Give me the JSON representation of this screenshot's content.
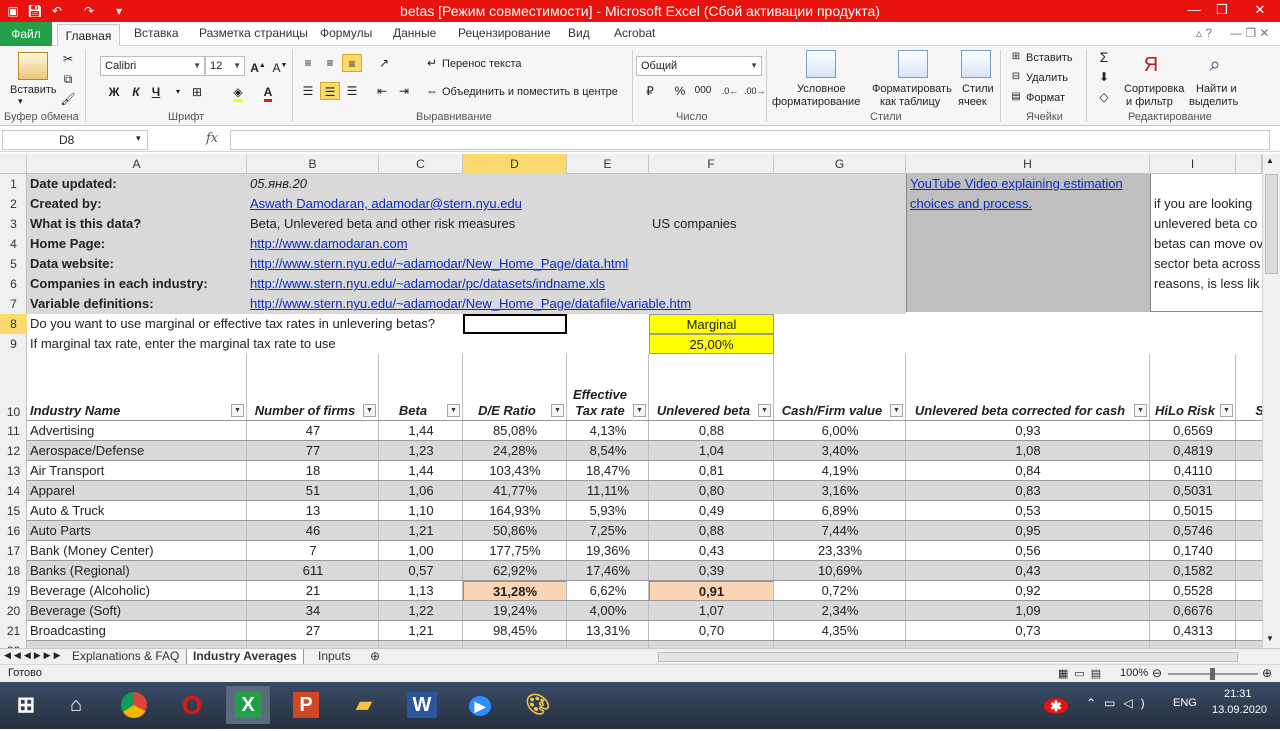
{
  "window": {
    "title": "betas  [Режим совместимости] - Microsoft Excel (Сбой активации продукта)"
  },
  "ribbon_tabs": [
    "Файл",
    "Главная",
    "Вставка",
    "Разметка страницы",
    "Формулы",
    "Данные",
    "Рецензирование",
    "Вид",
    "Acrobat"
  ],
  "ribbon": {
    "paste": "Вставить",
    "clipboard_group": "Буфер обмена",
    "font_name": "Calibri",
    "font_size": "12",
    "font_group": "Шрифт",
    "wrap_text": "Перенос текста",
    "merge_center": "Объединить и поместить в центре",
    "alignment_group": "Выравнивание",
    "number_format": "Общий",
    "number_group": "Число",
    "cond_format_1": "Условное",
    "cond_format_2": "форматирование",
    "format_table_1": "Форматировать",
    "format_table_2": "как таблицу",
    "cell_styles_1": "Стили",
    "cell_styles_2": "ячеек",
    "styles_group": "Стили",
    "insert": "Вставить",
    "delete": "Удалить",
    "format": "Формат",
    "cells_group": "Ячейки",
    "sort_1": "Сортировка",
    "sort_2": "и фильтр",
    "find_1": "Найти и",
    "find_2": "выделить",
    "editing_group": "Редактирование",
    "bold": "Ж",
    "italic": "К",
    "underline": "Ч",
    "percent": "%",
    "thousands": "000"
  },
  "formula_bar": {
    "name_box": "D8",
    "fx": "fx",
    "formula": ""
  },
  "columns": [
    "A",
    "B",
    "C",
    "D",
    "E",
    "F",
    "G",
    "H",
    "I"
  ],
  "rows": [
    "1",
    "2",
    "3",
    "4",
    "5",
    "6",
    "7",
    "8",
    "9",
    "10",
    "11",
    "12",
    "13",
    "14",
    "15",
    "16",
    "17",
    "18",
    "19",
    "20",
    "21",
    "22"
  ],
  "info": {
    "date_label": "Date updated:",
    "date_value": "05.янв.20",
    "created_label": "Created by:",
    "created_value": "Aswath Damodaran, adamodar@stern.nyu.edu",
    "what_label": "What is this data?",
    "what_value": "Beta, Unlevered beta and other risk measures",
    "what_region": "US companies",
    "home_label": "Home Page:",
    "home_value": "http://www.damodaran.com",
    "dataweb_label": "Data website:",
    "dataweb_value": "http://www.stern.nyu.edu/~adamodar/New_Home_Page/data.html",
    "companies_label": "Companies in each industry:",
    "companies_value": "http://www.stern.nyu.edu/~adamodar/pc/datasets/indname.xls",
    "vardef_label": "Variable definitions:",
    "vardef_value": "http://www.stern.nyu.edu/~adamodar/New_Home_Page/datafile/variable.htm",
    "video_link_1": "YouTube Video explaining estimation",
    "video_link_2": "choices and process.",
    "note_lines": [
      "if you are looking",
      "unlevered beta co",
      "betas can move ov",
      "sector beta across",
      "reasons, is less lik"
    ],
    "tax_question": "Do you want to use marginal or effective tax rates in unlevering betas?",
    "tax_choice": "Marginal",
    "marginal_question": "If marginal tax rate, enter the marginal tax rate to use",
    "marginal_value": "25,00%"
  },
  "table": {
    "headers": [
      "Industry  Name",
      "Number of firms",
      "Beta",
      "D/E Ratio",
      "Effective Tax rate",
      "Unlevered beta",
      "Cash/Firm value",
      "Unlevered beta corrected for cash",
      "HiLo Risk",
      "Sta"
    ],
    "rows": [
      {
        "name": "Advertising",
        "firms": "47",
        "beta": "1,44",
        "de": "85,08%",
        "tax": "4,13%",
        "ubeta": "0,88",
        "cash": "6,00%",
        "ubeta_cash": "0,93",
        "hilo": "0,6569"
      },
      {
        "name": "Aerospace/Defense",
        "firms": "77",
        "beta": "1,23",
        "de": "24,28%",
        "tax": "8,54%",
        "ubeta": "1,04",
        "cash": "3,40%",
        "ubeta_cash": "1,08",
        "hilo": "0,4819"
      },
      {
        "name": "Air Transport",
        "firms": "18",
        "beta": "1,44",
        "de": "103,43%",
        "tax": "18,47%",
        "ubeta": "0,81",
        "cash": "4,19%",
        "ubeta_cash": "0,84",
        "hilo": "0,4110"
      },
      {
        "name": "Apparel",
        "firms": "51",
        "beta": "1,06",
        "de": "41,77%",
        "tax": "11,11%",
        "ubeta": "0,80",
        "cash": "3,16%",
        "ubeta_cash": "0,83",
        "hilo": "0,5031"
      },
      {
        "name": "Auto & Truck",
        "firms": "13",
        "beta": "1,10",
        "de": "164,93%",
        "tax": "5,93%",
        "ubeta": "0,49",
        "cash": "6,89%",
        "ubeta_cash": "0,53",
        "hilo": "0,5015"
      },
      {
        "name": "Auto Parts",
        "firms": "46",
        "beta": "1,21",
        "de": "50,86%",
        "tax": "7,25%",
        "ubeta": "0,88",
        "cash": "7,44%",
        "ubeta_cash": "0,95",
        "hilo": "0,5746"
      },
      {
        "name": "Bank (Money Center)",
        "firms": "7",
        "beta": "1,00",
        "de": "177,75%",
        "tax": "19,36%",
        "ubeta": "0,43",
        "cash": "23,33%",
        "ubeta_cash": "0,56",
        "hilo": "0,1740"
      },
      {
        "name": "Banks (Regional)",
        "firms": "611",
        "beta": "0,57",
        "de": "62,92%",
        "tax": "17,46%",
        "ubeta": "0,39",
        "cash": "10,69%",
        "ubeta_cash": "0,43",
        "hilo": "0,1582"
      },
      {
        "name": "Beverage (Alcoholic)",
        "firms": "21",
        "beta": "1,13",
        "de": "31,28%",
        "tax": "6,62%",
        "ubeta": "0,91",
        "cash": "0,72%",
        "ubeta_cash": "0,92",
        "hilo": "0,5528"
      },
      {
        "name": "Beverage (Soft)",
        "firms": "34",
        "beta": "1,22",
        "de": "19,24%",
        "tax": "4,00%",
        "ubeta": "1,07",
        "cash": "2,34%",
        "ubeta_cash": "1,09",
        "hilo": "0,6676"
      },
      {
        "name": "Broadcasting",
        "firms": "27",
        "beta": "1,21",
        "de": "98,45%",
        "tax": "13,31%",
        "ubeta": "0,70",
        "cash": "4,35%",
        "ubeta_cash": "0,73",
        "hilo": "0,4313"
      }
    ]
  },
  "sheet_tabs": [
    "Explanations & FAQ",
    "Industry Averages",
    "Inputs"
  ],
  "status": {
    "ready": "Готово",
    "zoom": "100%"
  },
  "taskbar": {
    "lang": "ENG",
    "time": "21:31",
    "date": "13.09.2020"
  },
  "colors": {
    "title_bar": "#e8120e",
    "file_tab": "#21a049",
    "highlight_yellow": "#ffff00",
    "selected_fill": "#fbd4b4",
    "link": "#0a2cc2"
  }
}
